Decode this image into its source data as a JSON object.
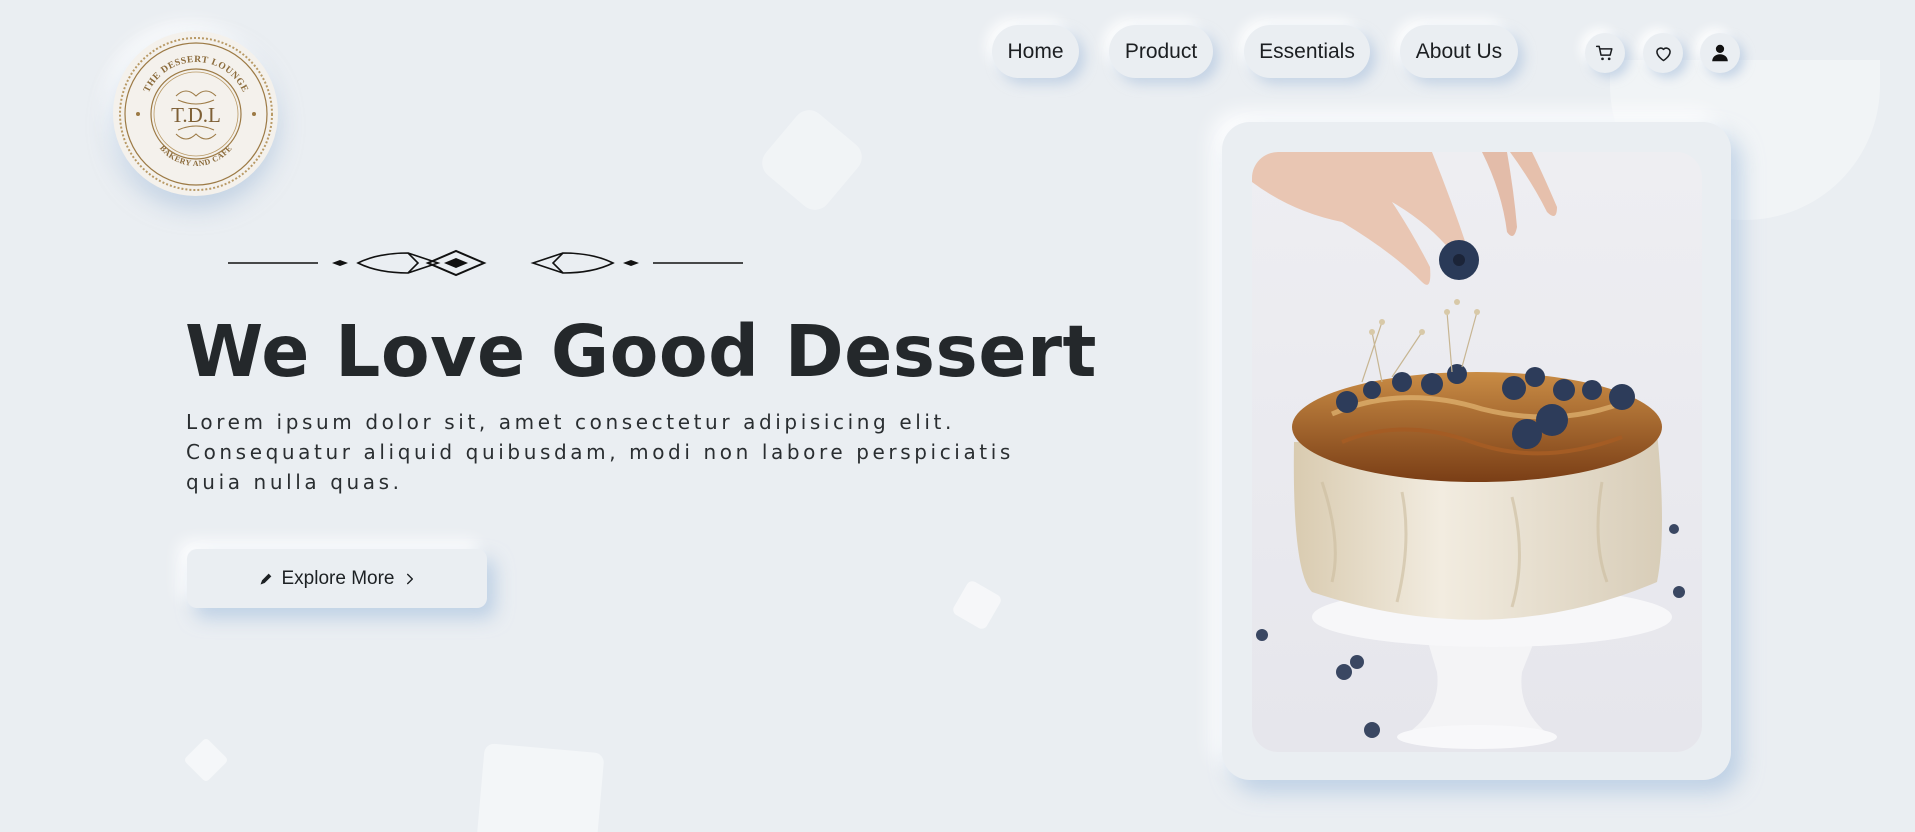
{
  "brand": {
    "logo_ring_top": "THE DESSERT LOUNGE",
    "logo_center": "T.D.L",
    "logo_ring_bottom": "BAKERY AND CAFE"
  },
  "nav": {
    "items": [
      {
        "label": "Home"
      },
      {
        "label": "Product"
      },
      {
        "label": "Essentials"
      },
      {
        "label": "About Us"
      }
    ],
    "icons": [
      "cart-icon",
      "heart-icon",
      "user-icon"
    ]
  },
  "hero": {
    "title": "We Love Good Dessert",
    "description": "Lorem ipsum dolor sit, amet consectetur adipisicing elit. Consequatur aliquid quibusdam, modi non labore perspiciatis quia nulla quas.",
    "cta_label": "Explore More"
  },
  "colors": {
    "background": "#eaeef2",
    "text": "#222629",
    "shadow": "#a5bedA",
    "logo_gold": "#9c7a45"
  }
}
